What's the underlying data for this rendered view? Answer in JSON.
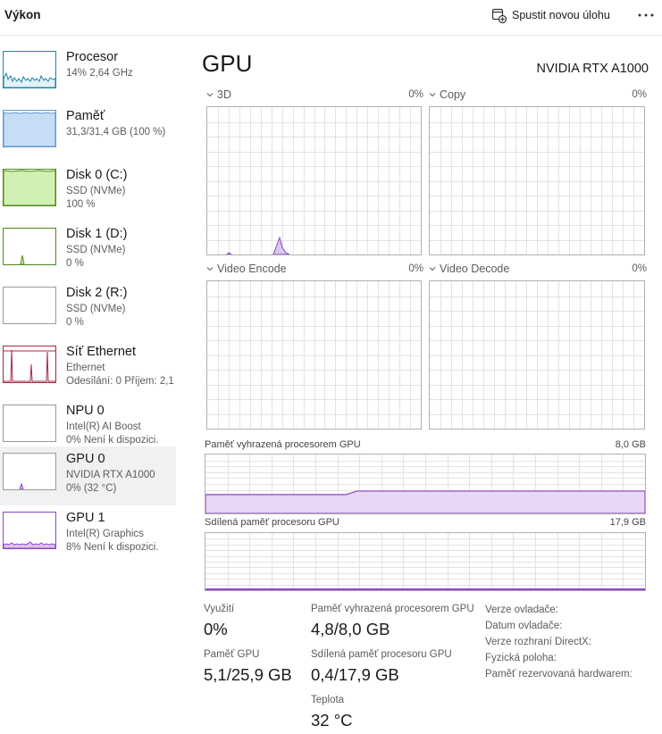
{
  "header": {
    "title": "Výkon",
    "new_task_label": "Spustit novou úlohu",
    "more_icon": "more-horizontal-icon"
  },
  "colors": {
    "cpu": "#1b86a3",
    "memory": "#5d98d6",
    "disk": "#4c8a17",
    "network": "#a82845",
    "gpu": "#8e44c4",
    "grid": "#e3e3e3"
  },
  "sidebar": {
    "items": [
      {
        "name": "Procesor",
        "sub1": "14% 2,64 GHz",
        "sub2": ""
      },
      {
        "name": "Paměť",
        "sub1": "31,3/31,4 GB (100 %)",
        "sub2": ""
      },
      {
        "name": "Disk 0 (C:)",
        "sub1": "SSD (NVMe)",
        "sub2": "100 %"
      },
      {
        "name": "Disk 1 (D:)",
        "sub1": "SSD (NVMe)",
        "sub2": "0 %"
      },
      {
        "name": "Disk 2 (R:)",
        "sub1": "SSD (NVMe)",
        "sub2": "0 %"
      },
      {
        "name": "Síť Ethernet",
        "sub1": "Ethernet",
        "sub2": "Odesílání: 0 Příjem: 2,1"
      },
      {
        "name": "NPU 0",
        "sub1": "Intel(R) AI Boost",
        "sub2": "0% Není k dispozici."
      },
      {
        "name": "GPU 0",
        "sub1": "NVIDIA RTX A1000",
        "sub2": "0% (32 °C)"
      },
      {
        "name": "GPU 1",
        "sub1": "Intel(R) Graphics",
        "sub2": "8% Není k dispozici."
      }
    ]
  },
  "main": {
    "title": "GPU",
    "model": "NVIDIA RTX A1000",
    "engines": [
      {
        "label": "3D",
        "percent": "0%"
      },
      {
        "label": "Copy",
        "percent": "0%"
      },
      {
        "label": "Video Encode",
        "percent": "0%"
      },
      {
        "label": "Video Decode",
        "percent": "0%"
      }
    ],
    "dedicated": {
      "label": "Paměť vyhrazená procesorem GPU",
      "max": "8,0 GB",
      "level_before": 0.32,
      "level_after": 0.38
    },
    "shared": {
      "label": "Sdílená paměť procesoru GPU",
      "max": "17,9 GB",
      "level": 0.02
    }
  },
  "stats": {
    "utilization_label": "Využití",
    "utilization_value": "0%",
    "gpu_memory_label": "Paměť GPU",
    "gpu_memory_value": "5,1/25,9 GB",
    "dedicated_label": "Paměť vyhrazená procesorem GPU",
    "dedicated_value": "4,8/8,0 GB",
    "shared_label": "Sdílená paměť procesoru GPU",
    "shared_value": "0,4/17,9 GB",
    "temp_label": "Teplota",
    "temp_value": "32 °C"
  },
  "info": {
    "driver_version": "Verze ovladače:",
    "driver_date": "Datum ovladače:",
    "directx": "Verze rozhraní DirectX:",
    "location": "Fyzická poloha:",
    "hw_reserved": "Paměť rezervovaná hardwarem:"
  }
}
